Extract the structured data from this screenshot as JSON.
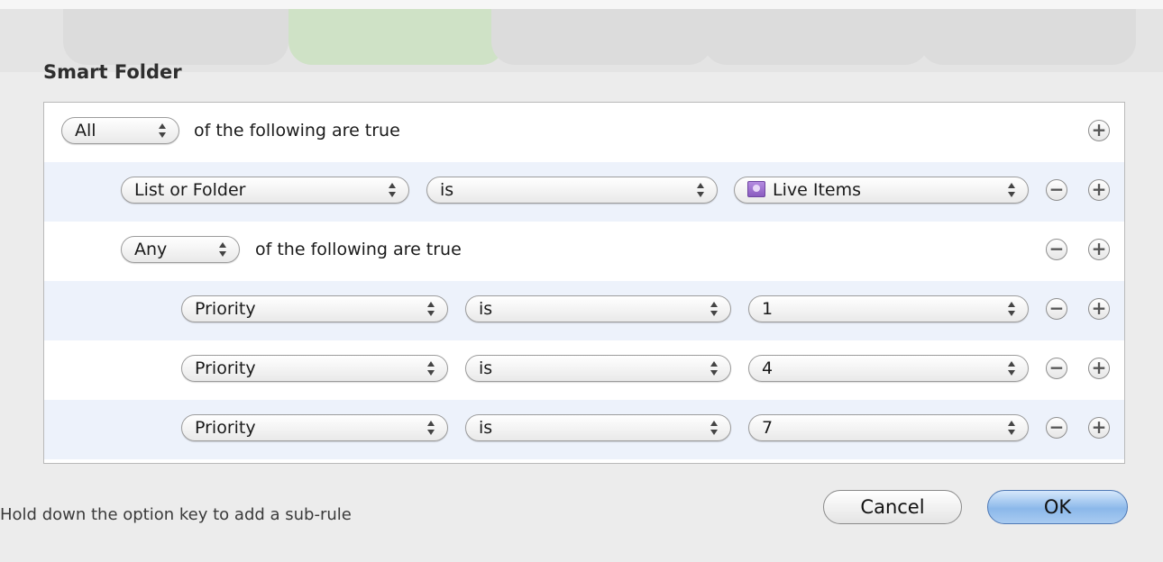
{
  "dialog": {
    "title": "Smart Folder",
    "hint": "Hold down the option key to add a sub-rule",
    "cancel_label": "Cancel",
    "ok_label": "OK"
  },
  "rules": {
    "top": {
      "match_value": "All",
      "suffix": "of the following are true"
    },
    "list_rule": {
      "field": "List or Folder",
      "operator": "is",
      "value": "Live Items"
    },
    "group": {
      "match_value": "Any",
      "suffix": "of the following are true"
    },
    "priority_rules": [
      {
        "field": "Priority",
        "operator": "is",
        "value": "1"
      },
      {
        "field": "Priority",
        "operator": "is",
        "value": "4"
      },
      {
        "field": "Priority",
        "operator": "is",
        "value": "7"
      }
    ]
  },
  "icons": {
    "add": "+",
    "remove": "−",
    "popup_arrows": "updown-arrows-icon",
    "folder": "smart-folder-icon"
  },
  "colors": {
    "ok_button": "#8bb8ea",
    "alt_row": "#edf2fb",
    "folder_icon": "#8a5cc0"
  }
}
